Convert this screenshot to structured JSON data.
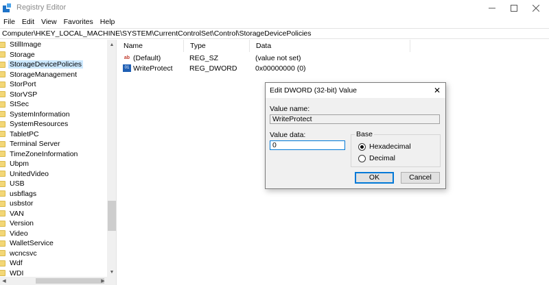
{
  "window": {
    "title": "Registry Editor",
    "icon": "regedit-icon",
    "minimize_icon": "minimize-icon",
    "maximize_icon": "maximize-icon",
    "close_icon": "close-icon"
  },
  "menu": [
    "File",
    "Edit",
    "View",
    "Favorites",
    "Help"
  ],
  "address": "Computer\\HKEY_LOCAL_MACHINE\\SYSTEM\\CurrentControlSet\\Control\\StorageDevicePolicies",
  "tree": {
    "items": [
      "StillImage",
      "Storage",
      "StorageDevicePolicies",
      "StorageManagement",
      "StorPort",
      "StorVSP",
      "StSec",
      "SystemInformation",
      "SystemResources",
      "TabletPC",
      "Terminal Server",
      "TimeZoneInformation",
      "Ubpm",
      "UnitedVideo",
      "USB",
      "usbflags",
      "usbstor",
      "VAN",
      "Version",
      "Video",
      "WalletService",
      "wcncsvc",
      "Wdf",
      "WDI"
    ],
    "selected_index": 2
  },
  "list": {
    "columns": [
      "Name",
      "Type",
      "Data"
    ],
    "rows": [
      {
        "name": "(Default)",
        "type": "REG_SZ",
        "data": "(value not set)",
        "icon": "string-value-icon"
      },
      {
        "name": "WriteProtect",
        "type": "REG_DWORD",
        "data": "0x00000000 (0)",
        "icon": "dword-value-icon"
      }
    ]
  },
  "dialog": {
    "title": "Edit DWORD (32-bit) Value",
    "value_name_label": "Value name:",
    "value_name": "WriteProtect",
    "value_data_label": "Value data:",
    "value_data": "0",
    "base_label": "Base",
    "hex_label": "Hexadecimal",
    "dec_label": "Decimal",
    "base_selected": "Hexadecimal",
    "ok_label": "OK",
    "cancel_label": "Cancel"
  }
}
